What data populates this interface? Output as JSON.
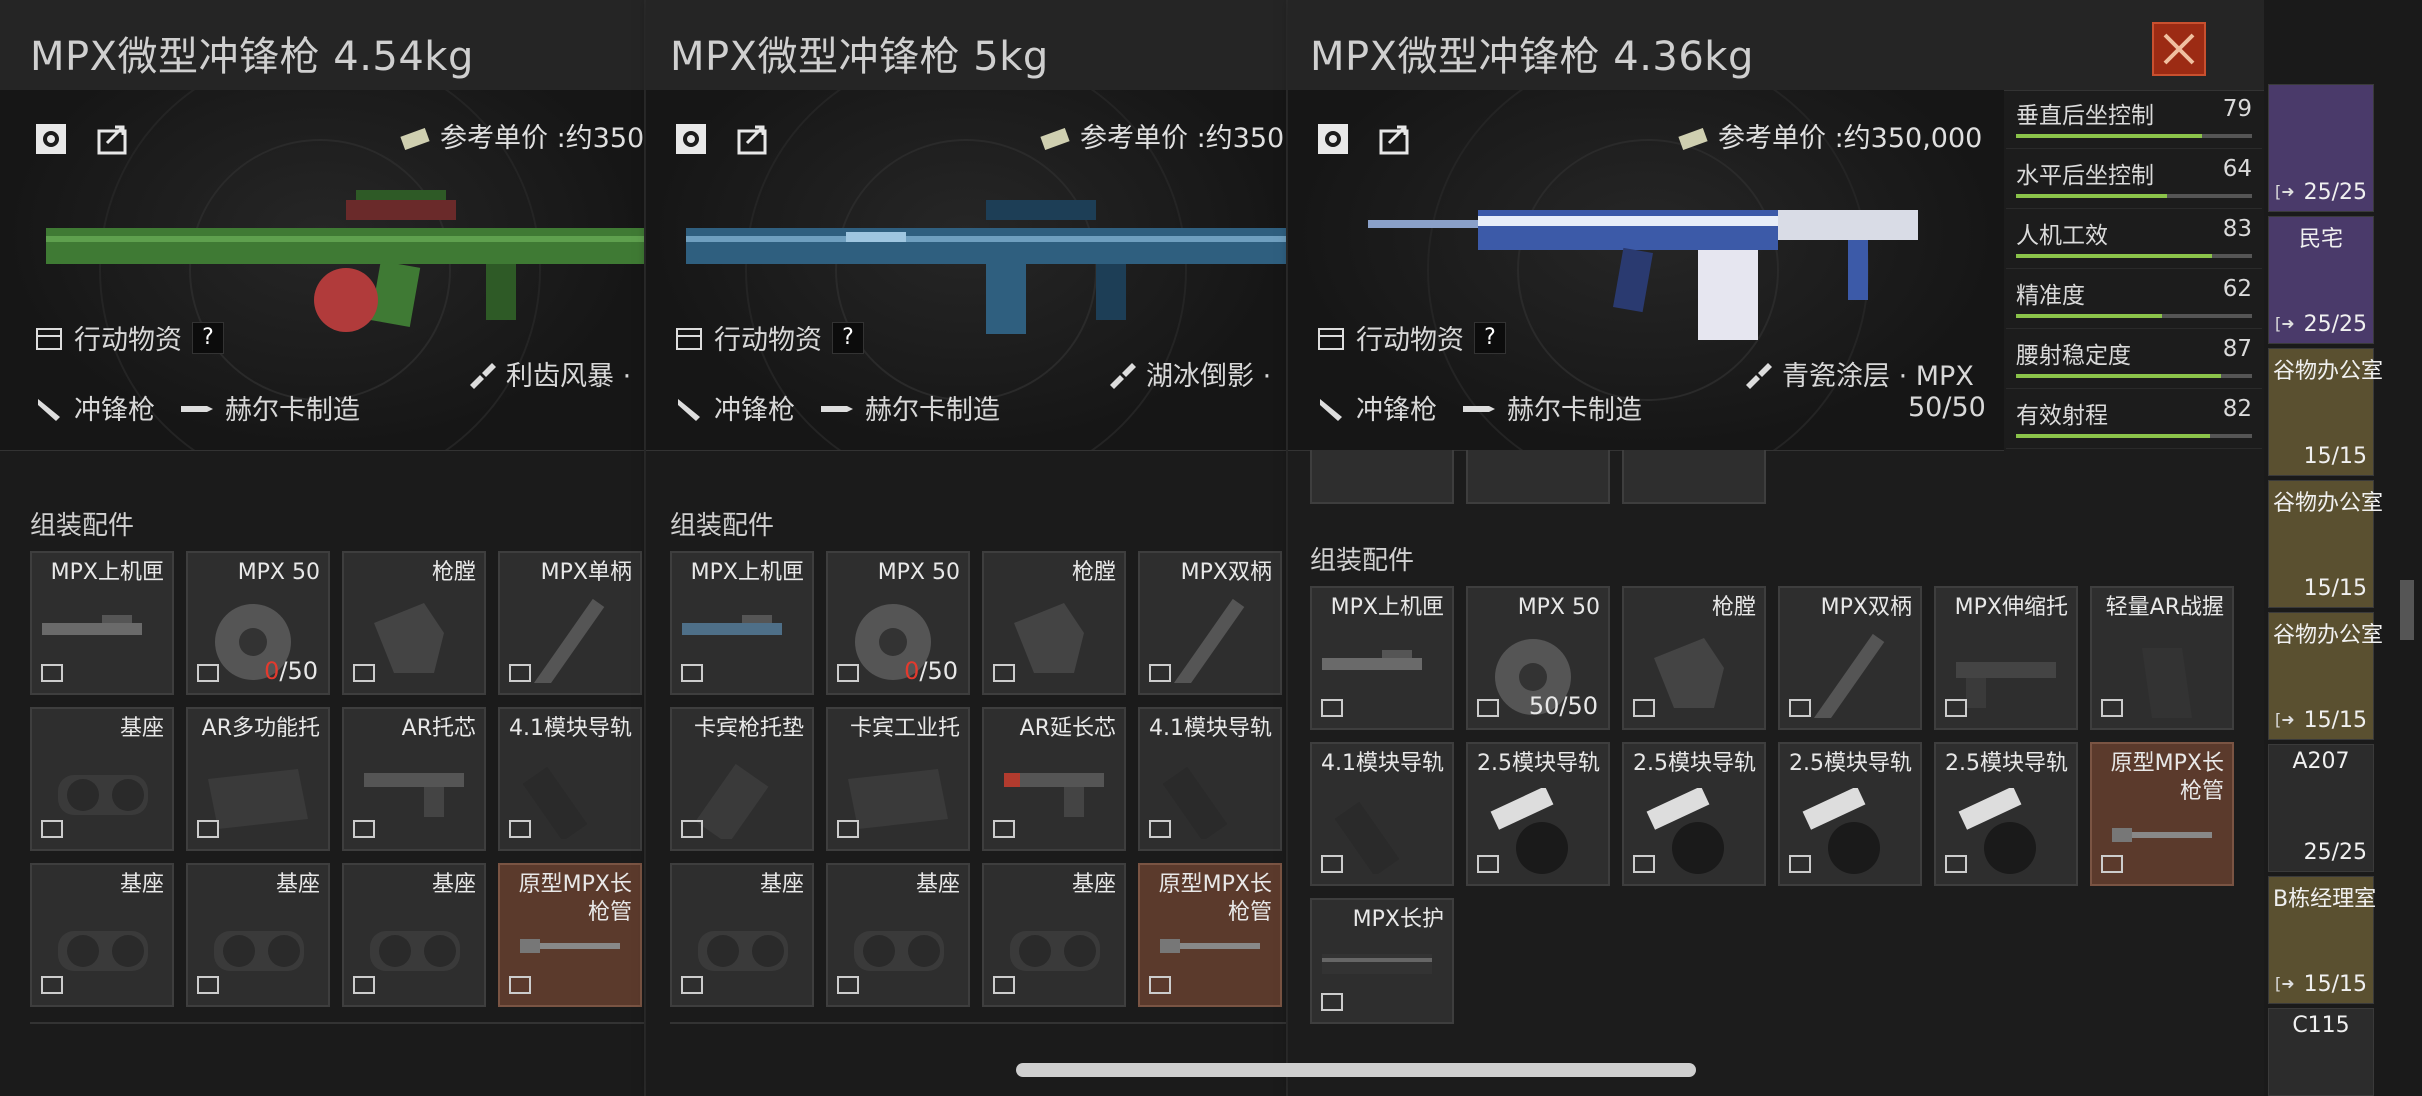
{
  "panels": [
    {
      "title": "MPX微型冲锋枪 4.54kg",
      "price": "参考单价 :约350",
      "category": "行动物资",
      "question_mark": "?",
      "type": "冲锋枪",
      "manufacturer": "赫尔卡制造",
      "skin": "利齿风暴 ·",
      "skin_color": "#3f7a34",
      "parts_label": "组装配件",
      "parts": [
        {
          "label": "MPX上机匣",
          "count": ""
        },
        {
          "label": "MPX 50",
          "count_red": "0",
          "count_rest": "/50"
        },
        {
          "label": "枪膛",
          "count": ""
        },
        {
          "label": "MPX单柄",
          "count": ""
        },
        {
          "label": "基座",
          "count": ""
        },
        {
          "label": "AR多功能托",
          "count": ""
        },
        {
          "label": "AR托芯",
          "count": ""
        },
        {
          "label": "4.1模块导轨",
          "count": ""
        },
        {
          "label": "基座",
          "count": ""
        },
        {
          "label": "基座",
          "count": ""
        },
        {
          "label": "基座",
          "count": ""
        },
        {
          "label": "原型MPX长枪管",
          "count": "",
          "special": true
        }
      ]
    },
    {
      "title": "MPX微型冲锋枪 5kg",
      "price": "参考单价 :约350",
      "category": "行动物资",
      "question_mark": "?",
      "type": "冲锋枪",
      "manufacturer": "赫尔卡制造",
      "skin": "湖冰倒影 ·",
      "skin_color": "#2f5f7f",
      "parts_label": "组装配件",
      "parts": [
        {
          "label": "MPX上机匣",
          "count": ""
        },
        {
          "label": "MPX 50",
          "count_red": "0",
          "count_rest": "/50"
        },
        {
          "label": "枪膛",
          "count": ""
        },
        {
          "label": "MPX双柄",
          "count": ""
        },
        {
          "label": "卡宾枪托垫",
          "count": ""
        },
        {
          "label": "卡宾工业托",
          "count": ""
        },
        {
          "label": "AR延长芯",
          "count": ""
        },
        {
          "label": "4.1模块导轨",
          "count": ""
        },
        {
          "label": "基座",
          "count": ""
        },
        {
          "label": "基座",
          "count": ""
        },
        {
          "label": "基座",
          "count": ""
        },
        {
          "label": "原型MPX长枪管",
          "count": "",
          "special": true
        }
      ]
    },
    {
      "title": "MPX微型冲锋枪 4.36kg",
      "price": "参考单价 :约350,000",
      "category": "行动物资",
      "question_mark": "?",
      "type": "冲锋枪",
      "manufacturer": "赫尔卡制造",
      "skin": "青瓷涂层 · MPX",
      "durability": "50/50",
      "skin_color": "#3c5aa8",
      "parts_label": "组装配件",
      "parts": [
        {
          "label": "MPX上机匣",
          "count": ""
        },
        {
          "label": "MPX 50",
          "count": "50/50"
        },
        {
          "label": "枪膛",
          "count": ""
        },
        {
          "label": "MPX双柄",
          "count": ""
        },
        {
          "label": "MPX伸缩托",
          "count": ""
        },
        {
          "label": "轻量AR战握",
          "count": ""
        },
        {
          "label": "4.1模块导轨",
          "count": ""
        },
        {
          "label": "2.5模块导轨",
          "count": ""
        },
        {
          "label": "2.5模块导轨",
          "count": ""
        },
        {
          "label": "2.5模块导轨",
          "count": ""
        },
        {
          "label": "2.5模块导轨",
          "count": ""
        },
        {
          "label": "原型MPX长枪管",
          "count": "",
          "special": true
        },
        {
          "label": "MPX长护",
          "count": ""
        }
      ],
      "stats": [
        {
          "name": "垂直后坐控制",
          "value": "79",
          "level": 0.79
        },
        {
          "name": "水平后坐控制",
          "value": "64",
          "level": 0.64
        },
        {
          "name": "人机工效",
          "value": "83",
          "level": 0.83
        },
        {
          "name": "精准度",
          "value": "62",
          "level": 0.62
        },
        {
          "name": "腰射稳定度",
          "value": "87",
          "level": 0.87
        },
        {
          "name": "有效射程",
          "value": "82",
          "level": 0.82
        }
      ]
    }
  ],
  "keys": [
    {
      "name": "",
      "count": "25/25",
      "color": "#4a3a6a"
    },
    {
      "name": "民宅",
      "count": "25/25",
      "color": "#4a3a6a"
    },
    {
      "name": "谷物办公室",
      "count": "15/15",
      "color": "#5a5030"
    },
    {
      "name": "谷物办公室",
      "count": "15/15",
      "color": "#5a5030"
    },
    {
      "name": "谷物办公室",
      "count": "15/15",
      "color": "#5a5030"
    },
    {
      "name": "A207",
      "count": "25/25",
      "color": "#2c2c2c"
    },
    {
      "name": "B栋经理室",
      "count": "15/15",
      "color": "#5a5030"
    },
    {
      "name": "C115",
      "count": "",
      "color": "#2c2c2c"
    }
  ],
  "colors": {
    "accent_green": "#8bc34a",
    "close_red": "#9c2b14",
    "part_special": "#5b3a2c"
  }
}
